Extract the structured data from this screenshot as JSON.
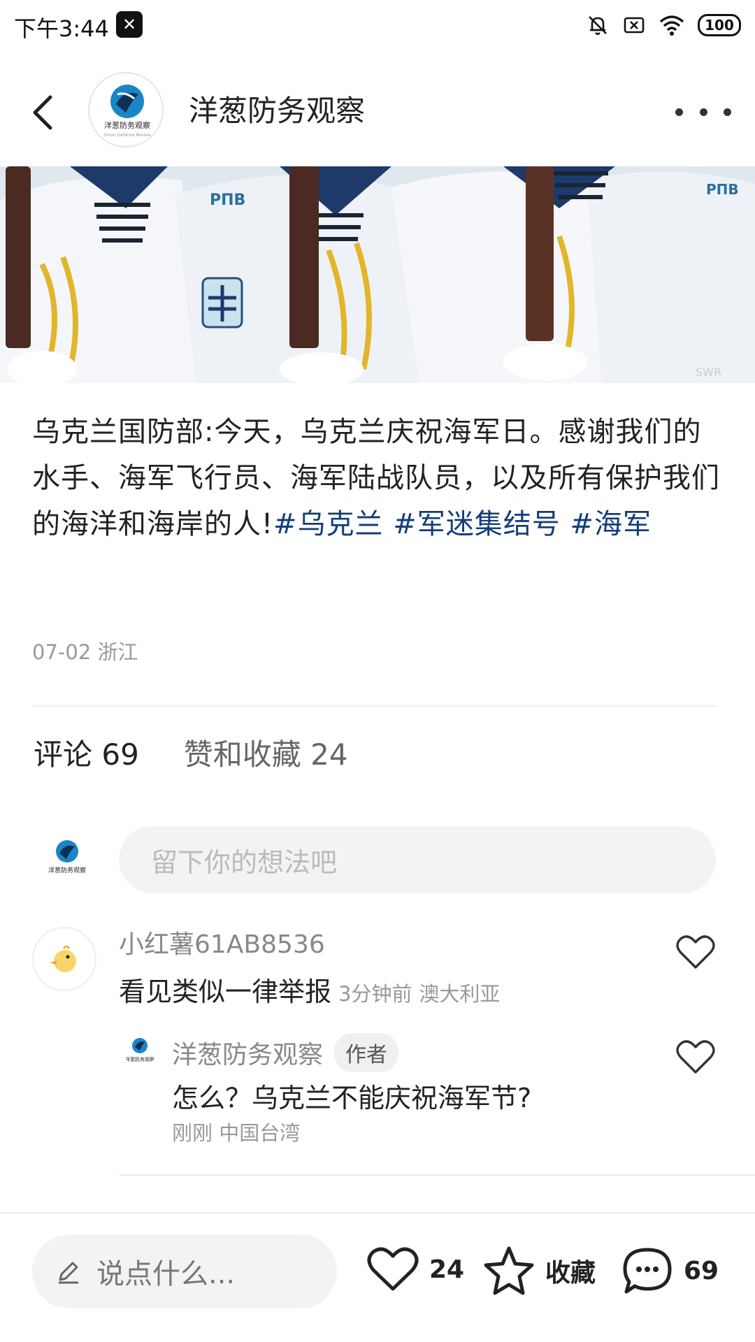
{
  "status_bar": {
    "time": "下午3:44",
    "battery": "100"
  },
  "header": {
    "title": "洋葱防务观察",
    "avatar_text": "洋葱防务观察",
    "avatar_subtext": "Onion Defense Review"
  },
  "hero": {
    "sleeve_badge": "РПВ",
    "watermark": "SWR"
  },
  "post": {
    "text": "乌克兰国防部:今天，乌克兰庆祝海军日。感谢我们的水手、海军飞行员、海军陆战队员，以及所有保护我们的海洋和海岸的人!",
    "hashtags": [
      "#乌克兰",
      "#军迷集结号",
      "#海军"
    ],
    "date": "07-02",
    "location": "浙江"
  },
  "tabs": {
    "comments": "评论 69",
    "likes": "赞和收藏 24"
  },
  "comment_input": {
    "placeholder": "留下你的想法吧"
  },
  "comments": [
    {
      "user": "小红薯61AB8536",
      "text": "看见类似一律举报",
      "time": "3分钟前",
      "location": "澳大利亚",
      "reply": {
        "user": "洋葱防务观察",
        "badge": "作者",
        "text": "怎么？乌克兰不能庆祝海军节?",
        "time": "刚刚",
        "location": "中国台湾"
      }
    }
  ],
  "bottom_bar": {
    "input_placeholder": "说点什么...",
    "like_count": "24",
    "favorite_label": "收藏",
    "comment_count": "69"
  }
}
